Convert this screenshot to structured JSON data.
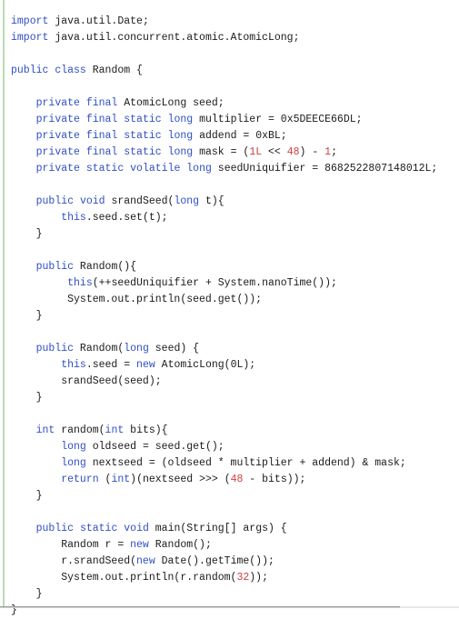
{
  "editor": {
    "language": "Java",
    "class_name": "Random",
    "background_color": "#ffffff",
    "gutter_stripe_color": "#b8dcb0",
    "rule_color": "#9a9a9a",
    "colors": {
      "keyword": "#2f4fc4",
      "number": "#cc4242",
      "plain": "#1a1a1a"
    }
  },
  "code": {
    "lines": [
      {
        "n": 1,
        "tokens": [
          {
            "t": "kw",
            "s": "import"
          },
          {
            "t": "pln",
            "s": " java.util.Date;"
          }
        ]
      },
      {
        "n": 2,
        "tokens": [
          {
            "t": "kw",
            "s": "import"
          },
          {
            "t": "pln",
            "s": " java.util.concurrent.atomic.AtomicLong;"
          }
        ]
      },
      {
        "n": 3,
        "tokens": []
      },
      {
        "n": 4,
        "tokens": [
          {
            "t": "kw",
            "s": "public"
          },
          {
            "t": "pln",
            "s": " "
          },
          {
            "t": "kw",
            "s": "class"
          },
          {
            "t": "pln",
            "s": " Random {"
          }
        ]
      },
      {
        "n": 5,
        "tokens": []
      },
      {
        "n": 6,
        "tokens": [
          {
            "t": "pln",
            "s": "    "
          },
          {
            "t": "kw",
            "s": "private"
          },
          {
            "t": "pln",
            "s": " "
          },
          {
            "t": "kw",
            "s": "final"
          },
          {
            "t": "pln",
            "s": " AtomicLong seed;"
          }
        ]
      },
      {
        "n": 7,
        "tokens": [
          {
            "t": "pln",
            "s": "    "
          },
          {
            "t": "kw",
            "s": "private"
          },
          {
            "t": "pln",
            "s": " "
          },
          {
            "t": "kw",
            "s": "final"
          },
          {
            "t": "pln",
            "s": " "
          },
          {
            "t": "kw",
            "s": "static"
          },
          {
            "t": "pln",
            "s": " "
          },
          {
            "t": "kw",
            "s": "long"
          },
          {
            "t": "pln",
            "s": " multiplier = 0x5DEECE66DL;"
          }
        ]
      },
      {
        "n": 8,
        "tokens": [
          {
            "t": "pln",
            "s": "    "
          },
          {
            "t": "kw",
            "s": "private"
          },
          {
            "t": "pln",
            "s": " "
          },
          {
            "t": "kw",
            "s": "final"
          },
          {
            "t": "pln",
            "s": " "
          },
          {
            "t": "kw",
            "s": "static"
          },
          {
            "t": "pln",
            "s": " "
          },
          {
            "t": "kw",
            "s": "long"
          },
          {
            "t": "pln",
            "s": " addend = 0xBL;"
          }
        ]
      },
      {
        "n": 9,
        "tokens": [
          {
            "t": "pln",
            "s": "    "
          },
          {
            "t": "kw",
            "s": "private"
          },
          {
            "t": "pln",
            "s": " "
          },
          {
            "t": "kw",
            "s": "final"
          },
          {
            "t": "pln",
            "s": " "
          },
          {
            "t": "kw",
            "s": "static"
          },
          {
            "t": "pln",
            "s": " "
          },
          {
            "t": "kw",
            "s": "long"
          },
          {
            "t": "pln",
            "s": " mask = ("
          },
          {
            "t": "num",
            "s": "1L"
          },
          {
            "t": "pln",
            "s": " << "
          },
          {
            "t": "num",
            "s": "48"
          },
          {
            "t": "pln",
            "s": ") - "
          },
          {
            "t": "num",
            "s": "1"
          },
          {
            "t": "pln",
            "s": ";"
          }
        ]
      },
      {
        "n": 10,
        "tokens": [
          {
            "t": "pln",
            "s": "    "
          },
          {
            "t": "kw",
            "s": "private"
          },
          {
            "t": "pln",
            "s": " "
          },
          {
            "t": "kw",
            "s": "static"
          },
          {
            "t": "pln",
            "s": " "
          },
          {
            "t": "kw",
            "s": "volatile"
          },
          {
            "t": "pln",
            "s": " "
          },
          {
            "t": "kw",
            "s": "long"
          },
          {
            "t": "pln",
            "s": " seedUniquifier = 8682522807148012L;"
          }
        ]
      },
      {
        "n": 11,
        "tokens": []
      },
      {
        "n": 12,
        "tokens": [
          {
            "t": "pln",
            "s": "    "
          },
          {
            "t": "kw",
            "s": "public"
          },
          {
            "t": "pln",
            "s": " "
          },
          {
            "t": "kw",
            "s": "void"
          },
          {
            "t": "pln",
            "s": " srandSeed("
          },
          {
            "t": "kw",
            "s": "long"
          },
          {
            "t": "pln",
            "s": " t){"
          }
        ]
      },
      {
        "n": 13,
        "tokens": [
          {
            "t": "pln",
            "s": "        "
          },
          {
            "t": "kw",
            "s": "this"
          },
          {
            "t": "pln",
            "s": ".seed.set(t);"
          }
        ]
      },
      {
        "n": 14,
        "tokens": [
          {
            "t": "pln",
            "s": "    }"
          }
        ]
      },
      {
        "n": 15,
        "tokens": []
      },
      {
        "n": 16,
        "tokens": [
          {
            "t": "pln",
            "s": "    "
          },
          {
            "t": "kw",
            "s": "public"
          },
          {
            "t": "pln",
            "s": " Random(){"
          }
        ]
      },
      {
        "n": 17,
        "tokens": [
          {
            "t": "pln",
            "s": "         "
          },
          {
            "t": "kw",
            "s": "this"
          },
          {
            "t": "pln",
            "s": "(++seedUniquifier + System.nanoTime());"
          }
        ]
      },
      {
        "n": 18,
        "tokens": [
          {
            "t": "pln",
            "s": "         System.out.println(seed.get());"
          }
        ]
      },
      {
        "n": 19,
        "tokens": [
          {
            "t": "pln",
            "s": "    }"
          }
        ]
      },
      {
        "n": 20,
        "tokens": []
      },
      {
        "n": 21,
        "tokens": [
          {
            "t": "pln",
            "s": "    "
          },
          {
            "t": "kw",
            "s": "public"
          },
          {
            "t": "pln",
            "s": " Random("
          },
          {
            "t": "kw",
            "s": "long"
          },
          {
            "t": "pln",
            "s": " seed) {"
          }
        ]
      },
      {
        "n": 22,
        "tokens": [
          {
            "t": "pln",
            "s": "        "
          },
          {
            "t": "kw",
            "s": "this"
          },
          {
            "t": "pln",
            "s": ".seed = "
          },
          {
            "t": "kw",
            "s": "new"
          },
          {
            "t": "pln",
            "s": " AtomicLong(0L);"
          }
        ]
      },
      {
        "n": 23,
        "tokens": [
          {
            "t": "pln",
            "s": "        srandSeed(seed);"
          }
        ]
      },
      {
        "n": 24,
        "tokens": [
          {
            "t": "pln",
            "s": "    }"
          }
        ]
      },
      {
        "n": 25,
        "tokens": []
      },
      {
        "n": 26,
        "tokens": [
          {
            "t": "pln",
            "s": "    "
          },
          {
            "t": "kw",
            "s": "int"
          },
          {
            "t": "pln",
            "s": " random("
          },
          {
            "t": "kw",
            "s": "int"
          },
          {
            "t": "pln",
            "s": " bits){"
          }
        ]
      },
      {
        "n": 27,
        "tokens": [
          {
            "t": "pln",
            "s": "        "
          },
          {
            "t": "kw",
            "s": "long"
          },
          {
            "t": "pln",
            "s": " oldseed = seed.get();"
          }
        ]
      },
      {
        "n": 28,
        "tokens": [
          {
            "t": "pln",
            "s": "        "
          },
          {
            "t": "kw",
            "s": "long"
          },
          {
            "t": "pln",
            "s": " nextseed = (oldseed * multiplier + addend) & mask;"
          }
        ]
      },
      {
        "n": 29,
        "tokens": [
          {
            "t": "pln",
            "s": "        "
          },
          {
            "t": "kw",
            "s": "return"
          },
          {
            "t": "pln",
            "s": " ("
          },
          {
            "t": "kw",
            "s": "int"
          },
          {
            "t": "pln",
            "s": ")(nextseed >>> ("
          },
          {
            "t": "num",
            "s": "48"
          },
          {
            "t": "pln",
            "s": " - bits));"
          }
        ]
      },
      {
        "n": 30,
        "tokens": [
          {
            "t": "pln",
            "s": "    }"
          }
        ]
      },
      {
        "n": 31,
        "tokens": []
      },
      {
        "n": 32,
        "tokens": [
          {
            "t": "pln",
            "s": "    "
          },
          {
            "t": "kw",
            "s": "public"
          },
          {
            "t": "pln",
            "s": " "
          },
          {
            "t": "kw",
            "s": "static"
          },
          {
            "t": "pln",
            "s": " "
          },
          {
            "t": "kw",
            "s": "void"
          },
          {
            "t": "pln",
            "s": " main(String[] args) {"
          }
        ]
      },
      {
        "n": 33,
        "tokens": [
          {
            "t": "pln",
            "s": "        Random r = "
          },
          {
            "t": "kw",
            "s": "new"
          },
          {
            "t": "pln",
            "s": " Random();"
          }
        ]
      },
      {
        "n": 34,
        "tokens": [
          {
            "t": "pln",
            "s": "        r.srandSeed("
          },
          {
            "t": "kw",
            "s": "new"
          },
          {
            "t": "pln",
            "s": " Date().getTime());"
          }
        ]
      },
      {
        "n": 35,
        "tokens": [
          {
            "t": "pln",
            "s": "        System.out.println(r.random("
          },
          {
            "t": "num",
            "s": "32"
          },
          {
            "t": "pln",
            "s": "));"
          }
        ]
      },
      {
        "n": 36,
        "tokens": [
          {
            "t": "pln",
            "s": "    }"
          }
        ]
      },
      {
        "n": 37,
        "tokens": [
          {
            "t": "pln",
            "s": "}"
          }
        ]
      }
    ]
  }
}
